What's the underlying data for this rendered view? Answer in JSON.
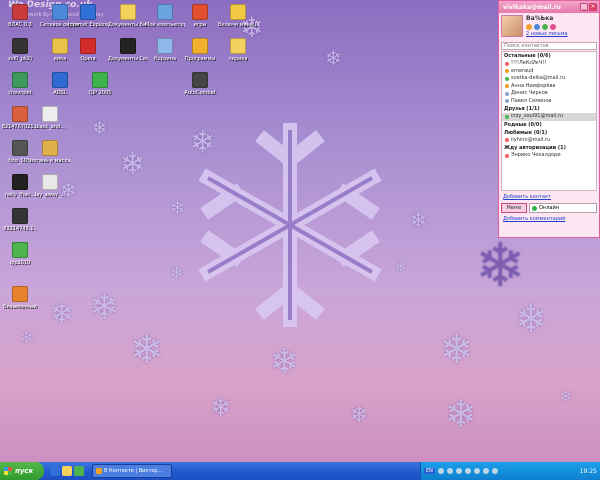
{
  "desktop": {
    "watermark": "Wa Design.co.uk",
    "watermark_sub": "Artwork By Bob Daoud Bhoolday",
    "icons": [
      {
        "label": "ВЛАС 0.3",
        "color": "#c83b3b"
      },
      {
        "label": "Сетевое окружение",
        "color": "#4a8ad8"
      },
      {
        "label": "Internet Explorer",
        "color": "#2f6fd6"
      },
      {
        "label": "Документы Вика",
        "color": "#f4d05c"
      },
      {
        "label": "Мой компьютер",
        "color": "#6aa3e0"
      },
      {
        "label": "игры",
        "color": "#e05030"
      },
      {
        "label": "Включи меня!!!",
        "color": "#f2c945"
      },
      {
        "label": "zvl0_pk2)",
        "color": "#333"
      },
      {
        "label": "вика",
        "color": "#e9c34c"
      },
      {
        "label": "Opera",
        "color": "#d62b2b"
      },
      {
        "label": "Документы Света",
        "color": "#222"
      },
      {
        "label": "Корзина",
        "color": "#8fb7e8"
      },
      {
        "label": "Программы",
        "color": "#f3b02e"
      },
      {
        "label": "лирика",
        "color": "#f4d05c"
      },
      {
        "label": "chevrolet",
        "color": "#3c9a5c"
      },
      {
        "label": "ADSL",
        "color": "#2d6bd1"
      },
      {
        "label": "QIP 2005",
        "color": "#3fb34a"
      },
      {
        "label": "AutoCombat",
        "color": "#444"
      },
      {
        "label": "8214767021...",
        "color": "#d8603c"
      },
      {
        "label": "black_and...",
        "color": "#eee"
      },
      {
        "label": "foto_50%",
        "color": "#555"
      },
      {
        "label": "погань и масла каменских",
        "color": "#e0b04a"
      },
      {
        "label": "nelly_fhan...",
        "color": "#222"
      },
      {
        "label": "lay_away_...",
        "color": "#e8e8e8"
      },
      {
        "label": "83214743.1..",
        "color": "#333"
      },
      {
        "label": "qip2010",
        "color": "#4cb34e"
      },
      {
        "label": "Безымянный",
        "color": "#e8822c"
      }
    ]
  },
  "agent": {
    "title": "vivikaka@mail.ru",
    "user_name": "Ва%Ька",
    "new_mail": "2 новых письма",
    "search_placeholder": "Поиск контактов",
    "groups": [
      {
        "name": "Остальные (0/6)",
        "contacts": [
          "!!!!ЛеКсИкЧ!!",
          "emeraud",
          "svetka-delka@mail.ru",
          "Анна Ниифорёва",
          "Денис Чирков",
          "Павел Семенов"
        ]
      },
      {
        "name": "Друзья (1/1)",
        "contacts": [
          "crzy_soul91@mail.ru"
        ]
      },
      {
        "name": "Родные (0/0)",
        "contacts": []
      },
      {
        "name": "Любимые (0/1)",
        "contacts": [
          "ilyhinn@mail.ru"
        ]
      },
      {
        "name": "Жду авторизации (1)",
        "contacts": [
          "Энрико Чекалдори"
        ]
      }
    ],
    "add_contact": "Добавить контакт",
    "menu_label": "Меню",
    "status_label": "Онлайн",
    "add_comment": "Добавить комментарий"
  },
  "taskbar": {
    "start_label": "пуск",
    "task_label": "В Контакте | Виктор...",
    "lang": "EN",
    "clock": "19:25"
  }
}
